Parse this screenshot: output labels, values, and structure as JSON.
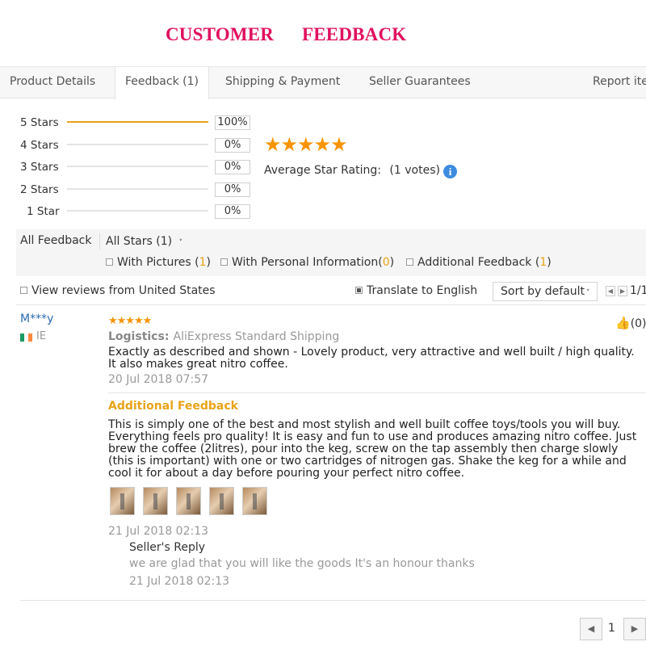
{
  "headline": {
    "left": "CUSTOMER",
    "right": "FEEDBACK"
  },
  "tabs": [
    {
      "label": "Product Details"
    },
    {
      "label": "Feedback (1)"
    },
    {
      "label": "Shipping & Payment"
    },
    {
      "label": "Seller Guarantees"
    },
    {
      "label": "Report ite"
    }
  ],
  "distribution": [
    {
      "label": "5 Stars",
      "percent": "100%",
      "fill": 1.0
    },
    {
      "label": "4 Stars",
      "percent": "0%",
      "fill": 0
    },
    {
      "label": "3 Stars",
      "percent": "0%",
      "fill": 0
    },
    {
      "label": "2 Stars",
      "percent": "0%",
      "fill": 0
    },
    {
      "label": "1 Star",
      "percent": "0%",
      "fill": 0
    }
  ],
  "rating": {
    "stars": "★★★★★",
    "label": "Average Star Rating:",
    "votes": "(1 votes)",
    "info_icon": "i"
  },
  "filters": {
    "all_feedback": "All Feedback",
    "all_stars": "All Stars (1)",
    "all_stars_caret": "˅",
    "with_pictures": {
      "label": "With Pictures (",
      "count": "1",
      "close": ")"
    },
    "with_personal": {
      "label": "With Personal Information(",
      "count": "0",
      "close": ")"
    },
    "additional": {
      "label": "Additional Feedback (",
      "count": "1",
      "close": ")"
    }
  },
  "options": {
    "view_us": "View reviews from United States",
    "view_us_checked": false,
    "translate": "Translate to English",
    "translate_checked": true,
    "sort": "Sort by default",
    "sort_caret": "˅",
    "prev": "◀",
    "next": "▶",
    "page": "1/1"
  },
  "review": {
    "reviewer": "M***y",
    "country": "IE",
    "flag_colors": [
      "#169b62",
      "#ffffff",
      "#ff883e"
    ],
    "stars": "★★★★★",
    "logistics_label": "Logistics:",
    "logistics_value": "AliExpress Standard Shipping",
    "text": "Exactly as described and shown - Lovely product, very attractive and well built / high quality. It also makes great nitro coffee.",
    "date": "20 Jul 2018 07:57",
    "helpful_icon": "👍",
    "helpful": "(0)",
    "additional_title": "Additional Feedback",
    "additional_text": "This is simply one of the best and most stylish and well built coffee toys/tools you will buy. Everything feels pro quality! It is easy and fun to use and produces amazing nitro coffee. Just brew the coffee (2litres), pour into the keg, screw on the tap assembly then charge slowly (this is important) with one or two cartridges of nitrogen gas. Shake the keg for a while and cool it for about a day before pouring your perfect nitro coffee.",
    "additional_date": "21 Jul 2018 02:13",
    "reply_title": "Seller's Reply",
    "reply_text": "we are glad that you will like the goods It's an honour thanks",
    "reply_date": "21 Jul 2018 02:13"
  },
  "pager": {
    "prev": "◀",
    "current": "1",
    "next": "▶"
  }
}
